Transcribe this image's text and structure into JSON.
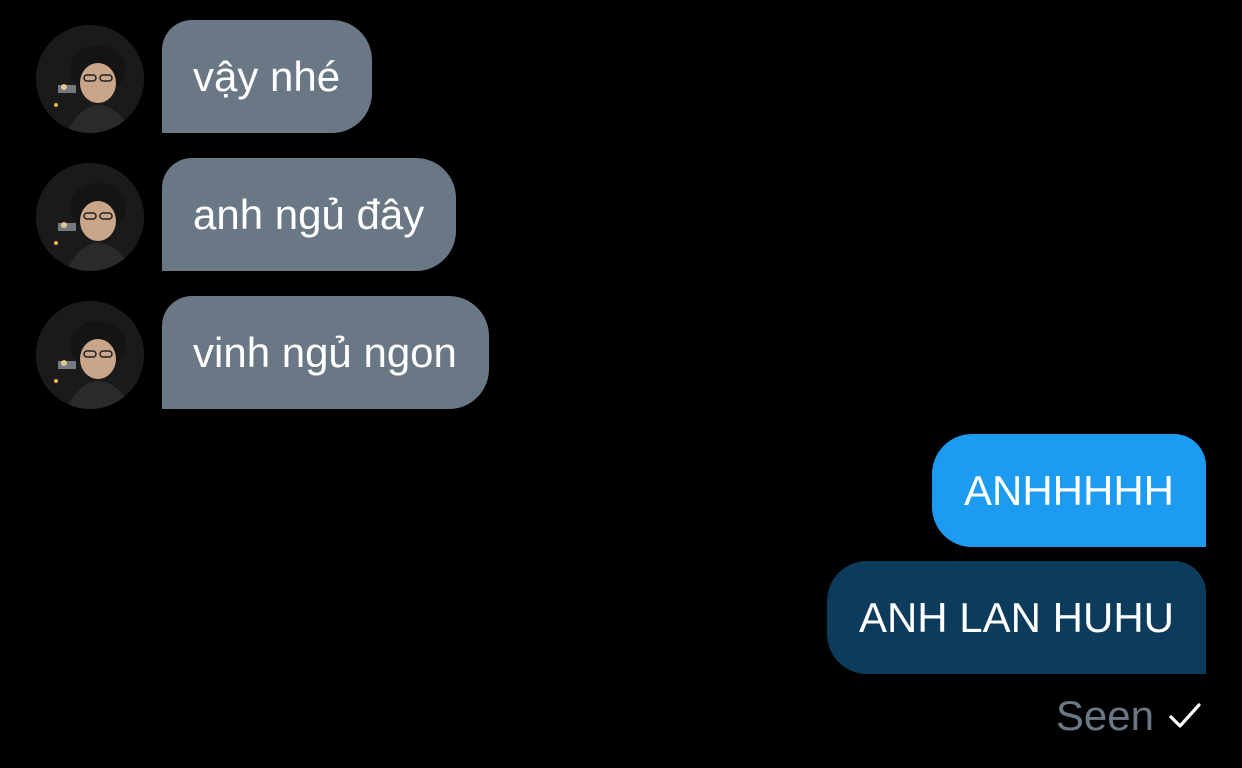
{
  "conversation": {
    "incoming": [
      {
        "text": "vậy nhé",
        "avatar_icon": "user-avatar-icon"
      },
      {
        "text": "anh ngủ đây",
        "avatar_icon": "user-avatar-icon"
      },
      {
        "text": "vinh ngủ ngon",
        "avatar_icon": "user-avatar-icon"
      }
    ],
    "outgoing": [
      {
        "text": "ANHHHHH"
      },
      {
        "text": "ANH LAN HUHU"
      }
    ],
    "status": {
      "label": "Seen",
      "icon": "checkmark-icon"
    }
  },
  "colors": {
    "background": "#000000",
    "incoming_bubble": "#6a7885",
    "outgoing_bubble_primary": "#1d9bf0",
    "outgoing_bubble_secondary": "#0c3b5c",
    "status_text": "#6a7885",
    "text": "#ffffff"
  }
}
